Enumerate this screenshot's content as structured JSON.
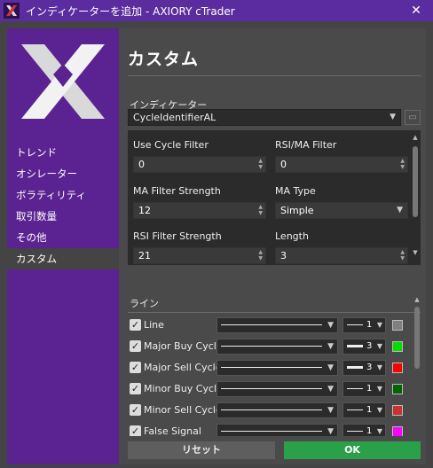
{
  "window": {
    "title": "インディケーターを追加 - AXIORY cTrader"
  },
  "sidebar": {
    "items": [
      {
        "label": "トレンド"
      },
      {
        "label": "オシレーター"
      },
      {
        "label": "ボラティリティ"
      },
      {
        "label": "取引数量"
      },
      {
        "label": "その他"
      },
      {
        "label": "カスタム"
      }
    ],
    "active_index": 5
  },
  "main": {
    "heading": "カスタム",
    "indicator_label": "インディケーター",
    "indicator_value": "CycleIdentifierAL",
    "params": [
      {
        "label": "Use Cycle Filter",
        "value": "0",
        "kind": "number"
      },
      {
        "label": "RSI/MA Filter",
        "value": "0",
        "kind": "number"
      },
      {
        "label": "MA Filter Strength",
        "value": "12",
        "kind": "number"
      },
      {
        "label": "MA Type",
        "value": "Simple",
        "kind": "select"
      },
      {
        "label": "RSI Filter Strength",
        "value": "21",
        "kind": "number"
      },
      {
        "label": "Length",
        "value": "3",
        "kind": "number"
      }
    ],
    "lines_label": "ライン",
    "lines": [
      {
        "name": "Line",
        "thickness": "1",
        "color": "#808080"
      },
      {
        "name": "Major Buy Cycle",
        "thickness": "3",
        "color": "#00e000"
      },
      {
        "name": "Major Sell Cycle",
        "thickness": "3",
        "color": "#ff0000"
      },
      {
        "name": "Minor Buy Cycle",
        "thickness": "1",
        "color": "#006400"
      },
      {
        "name": "Minor Sell Cycle",
        "thickness": "1",
        "color": "#c83232"
      },
      {
        "name": "False Signal",
        "thickness": "1",
        "color": "#ff00ff"
      }
    ]
  },
  "footer": {
    "reset_label": "リセット",
    "ok_label": "OK"
  },
  "colors": {
    "titlebar": "#5b2ca0",
    "sidebar": "#5b2391",
    "ok": "#2aa04a"
  }
}
